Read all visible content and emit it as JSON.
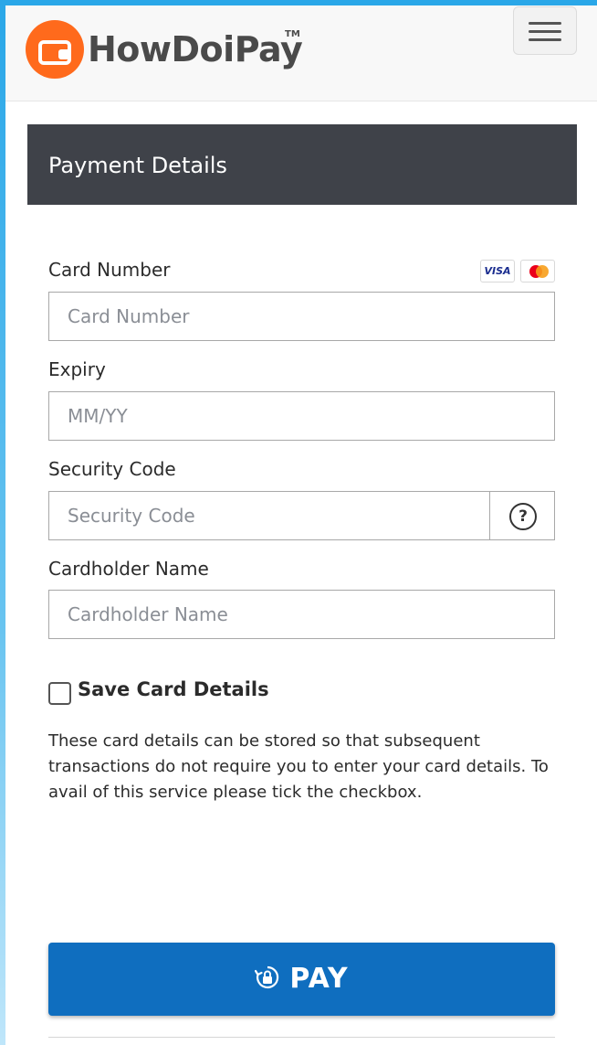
{
  "brand": {
    "name": "HowDoiPay",
    "trademark": "TM",
    "accent_color": "#ff6a1c"
  },
  "header": {
    "menu_icon": "hamburger-menu-icon"
  },
  "page": {
    "title": "Payment Details"
  },
  "form": {
    "card_number": {
      "label": "Card Number",
      "placeholder": "Card Number",
      "accepted_cards": [
        "VISA",
        "mastercard"
      ]
    },
    "expiry": {
      "label": "Expiry",
      "placeholder": "MM/YY"
    },
    "security_code": {
      "label": "Security Code",
      "placeholder": "Security Code",
      "help_symbol": "?"
    },
    "cardholder_name": {
      "label": "Cardholder Name",
      "placeholder": "Cardholder Name"
    },
    "save_card": {
      "label": "Save Card Details",
      "checked": false
    },
    "info_text": "These card details can be stored so that subsequent transactions do not require you to enter your card details. To avail of this service please tick the checkbox."
  },
  "pay_button": {
    "label": "PAY",
    "icon": "secure-lock-icon",
    "color": "#0f6ebf"
  }
}
